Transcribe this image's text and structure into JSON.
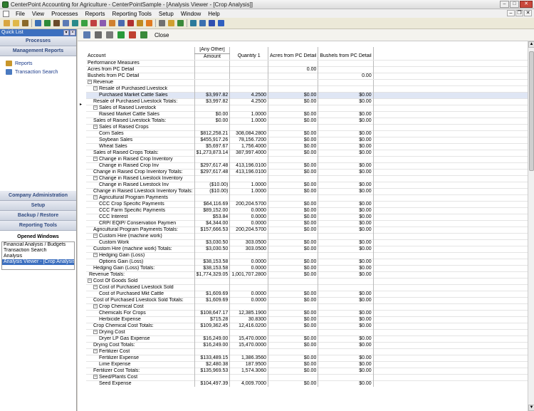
{
  "window": {
    "title": "CenterPoint Accounting for Agriculture - CenterPointSample - [Analysis Viewer - [Crop Analysis]]",
    "minimize_glyph": "–",
    "maximize_glyph": "□",
    "close_glyph": "✕"
  },
  "menu": {
    "items": [
      "File",
      "View",
      "Processes",
      "Reports",
      "Reporting Tools",
      "Setup",
      "Window",
      "Help"
    ],
    "mdi_minimize": "–",
    "mdi_restore": "❐",
    "mdi_close": "✕"
  },
  "toolbar": {
    "icons": [
      {
        "name": "new-icon",
        "color": "#d9a640"
      },
      {
        "name": "open-icon",
        "color": "#e0b84a"
      },
      {
        "name": "scale-icon",
        "color": "#8a6a2a"
      },
      {
        "name": "sep"
      },
      {
        "name": "contacts-icon",
        "color": "#3a6fb5"
      },
      {
        "name": "chart-icon",
        "color": "#2e8b3a"
      },
      {
        "name": "box-icon",
        "color": "#6a4a2a"
      },
      {
        "name": "grid-icon",
        "color": "#5a7ab5"
      },
      {
        "name": "ledger-icon",
        "color": "#2a8a8a"
      },
      {
        "name": "money-icon",
        "color": "#3aa040"
      },
      {
        "name": "invoice-icon",
        "color": "#c04040"
      },
      {
        "name": "payroll-icon",
        "color": "#8a5ab0"
      },
      {
        "name": "bank-icon",
        "color": "#d08030"
      },
      {
        "name": "report-icon",
        "color": "#4a6ab0"
      },
      {
        "name": "tractor-icon",
        "color": "#b03030"
      },
      {
        "name": "calendar-icon",
        "color": "#c08a20"
      },
      {
        "name": "clock-icon",
        "color": "#e07a20"
      },
      {
        "name": "sep"
      },
      {
        "name": "print-icon",
        "color": "#707070"
      },
      {
        "name": "email-icon",
        "color": "#d0a030"
      },
      {
        "name": "export-icon",
        "color": "#3a8a3a"
      },
      {
        "name": "sep"
      },
      {
        "name": "globe-icon",
        "color": "#2a7a9a"
      },
      {
        "name": "web-icon",
        "color": "#3a70b0"
      },
      {
        "name": "help-icon",
        "color": "#3050b0"
      },
      {
        "name": "info-icon",
        "color": "#3060c0"
      }
    ]
  },
  "quick_list": {
    "title": "Quick List",
    "pin_glyph": "▾",
    "close_glyph": "×",
    "top_sections": [
      "Processes",
      "Management Reports"
    ],
    "items": [
      {
        "label": "Reports",
        "icon": "reports-icon",
        "color": "#c8962a"
      },
      {
        "label": "Transaction Search",
        "icon": "search-icon",
        "color": "#4a7ac0"
      }
    ],
    "bottom_sections": [
      "Company Administration",
      "Setup",
      "Backup / Restore",
      "Reporting Tools"
    ],
    "opened_windows_title": "Opened Windows",
    "opened_windows": [
      {
        "label": "Financial Analysis / Budgets",
        "selected": false
      },
      {
        "label": "Transaction Search",
        "selected": false
      },
      {
        "label": "Analysis",
        "selected": false
      },
      {
        "label": "Analysis Viewer - [Crop Analysis]",
        "selected": true
      }
    ]
  },
  "viewer": {
    "toolbar_icons": [
      {
        "name": "save-icon",
        "color": "#5a7ab0"
      },
      {
        "name": "print-icon",
        "color": "#6a6a6a"
      },
      {
        "name": "preview-icon",
        "color": "#7a7a7a"
      },
      {
        "name": "filter-icon",
        "color": "#2a9a3a"
      },
      {
        "name": "excel-icon",
        "color": "#c04030"
      },
      {
        "name": "export-icon",
        "color": "#3a8a3a"
      }
    ],
    "close_label": "Close",
    "grid": {
      "header_group": "[Any Other]",
      "columns": [
        "Account",
        "Amount",
        "Quantity 1",
        "Acres from PC Detail",
        "Bushels from PC Detail"
      ],
      "performance": [
        {
          "label": "Performance Measures",
          "values": [
            "",
            "",
            "",
            ""
          ]
        },
        {
          "label": "Acres from PC Detail",
          "values": [
            "",
            "",
            "0.00",
            ""
          ]
        },
        {
          "label": "Bushels from PC Detail",
          "values": [
            "",
            "",
            "",
            "0.00"
          ]
        }
      ],
      "rows": [
        {
          "l": 0,
          "t": "g",
          "x": "Revenue"
        },
        {
          "l": 1,
          "t": "g",
          "x": "Resale of Purchased Livestock"
        },
        {
          "l": 2,
          "t": "d",
          "x": "Purchased Market Cattle Sales",
          "v": [
            "$3,997.82",
            "4.2500",
            "$0.00",
            "$0.00"
          ],
          "sel": true
        },
        {
          "l": 1,
          "t": "t",
          "x": "Resale of Purchased Livestock Totals:",
          "v": [
            "$3,997.82",
            "4.2500",
            "$0.00",
            "$0.00"
          ]
        },
        {
          "l": 1,
          "t": "g",
          "x": "Sales of Raised Livestock"
        },
        {
          "l": 2,
          "t": "d",
          "x": "Raised Market Cattle Sales",
          "v": [
            "$0.00",
            "1.0000",
            "$0.00",
            "$0.00"
          ]
        },
        {
          "l": 1,
          "t": "t",
          "x": "Sales of Raised Livestock Totals:",
          "v": [
            "$0.00",
            "1.0000",
            "$0.00",
            "$0.00"
          ]
        },
        {
          "l": 1,
          "t": "g",
          "x": "Sales of Raised Crops"
        },
        {
          "l": 2,
          "t": "d",
          "x": "Corn Sales",
          "v": [
            "$812,258.21",
            "308,084.2800",
            "$0.00",
            "$0.00"
          ]
        },
        {
          "l": 2,
          "t": "d",
          "x": "Soybean Sales",
          "v": [
            "$455,917.26",
            "78,156.7200",
            "$0.00",
            "$0.00"
          ]
        },
        {
          "l": 2,
          "t": "d",
          "x": "Wheat Sales",
          "v": [
            "$5,697.67",
            "1,756.4000",
            "$0.00",
            "$0.00"
          ]
        },
        {
          "l": 1,
          "t": "t",
          "x": "Sales of Raised Crops Totals:",
          "v": [
            "$1,273,873.14",
            "387,997.4000",
            "$0.00",
            "$0.00"
          ]
        },
        {
          "l": 1,
          "t": "g",
          "x": "Change in Raised Crop Inventory"
        },
        {
          "l": 2,
          "t": "d",
          "x": "Change in Raised Crop Inv",
          "v": [
            "$297,617.48",
            "413,196.0100",
            "$0.00",
            "$0.00"
          ]
        },
        {
          "l": 1,
          "t": "t",
          "x": "Change in Raised Crop Inventory Totals:",
          "v": [
            "$297,617.48",
            "413,196.0100",
            "$0.00",
            "$0.00"
          ]
        },
        {
          "l": 1,
          "t": "g",
          "x": "Change in Raised Livestock Inventory"
        },
        {
          "l": 2,
          "t": "d",
          "x": "Change in Raised Livestock Inv",
          "v": [
            "($10.00)",
            "1.0000",
            "$0.00",
            "$0.00"
          ]
        },
        {
          "l": 1,
          "t": "t",
          "x": "Change in Raised Livestock Inventory Totals:",
          "v": [
            "($10.00)",
            "1.0000",
            "$0.00",
            "$0.00"
          ]
        },
        {
          "l": 1,
          "t": "g",
          "x": "Agricultural Program Payments"
        },
        {
          "l": 2,
          "t": "d",
          "x": "CCC Crop Specific Payments",
          "v": [
            "$64,116.69",
            "200,204.5700",
            "$0.00",
            "$0.00"
          ]
        },
        {
          "l": 2,
          "t": "d",
          "x": "CCC Farm Specific Payments",
          "v": [
            "$89,152.00",
            "0.0000",
            "$0.00",
            "$0.00"
          ]
        },
        {
          "l": 2,
          "t": "d",
          "x": "CCC Interest",
          "v": [
            "$53.84",
            "0.0000",
            "$0.00",
            "$0.00"
          ]
        },
        {
          "l": 2,
          "t": "d",
          "x": "CRP/ EQIP/ Conservation Paymen",
          "v": [
            "$4,344.00",
            "0.0000",
            "$0.00",
            "$0.00"
          ]
        },
        {
          "l": 1,
          "t": "t",
          "x": "Agricultural Program Payments Totals:",
          "v": [
            "$157,666.53",
            "200,204.5700",
            "$0.00",
            "$0.00"
          ]
        },
        {
          "l": 1,
          "t": "g",
          "x": "Custom Hire (machine work)"
        },
        {
          "l": 2,
          "t": "d",
          "x": "Custom Work",
          "v": [
            "$3,030.50",
            "303.0500",
            "$0.00",
            "$0.00"
          ]
        },
        {
          "l": 1,
          "t": "t",
          "x": "Custom Hire (machine work) Totals:",
          "v": [
            "$3,030.50",
            "303.0500",
            "$0.00",
            "$0.00"
          ]
        },
        {
          "l": 1,
          "t": "g",
          "x": "Hedging Gain (Loss)"
        },
        {
          "l": 2,
          "t": "d",
          "x": "Options Gain (Loss)",
          "v": [
            "$38,153.58",
            "0.0000",
            "$0.00",
            "$0.00"
          ]
        },
        {
          "l": 1,
          "t": "t",
          "x": "Hedging Gain (Loss) Totals:",
          "v": [
            "$38,153.58",
            "0.0000",
            "$0.00",
            "$0.00"
          ]
        },
        {
          "l": 0,
          "t": "t",
          "x": "Revenue Totals:",
          "v": [
            "$1,774,329.05",
            "1,001,707.2800",
            "$0.00",
            "$0.00"
          ]
        },
        {
          "l": 0,
          "t": "g",
          "x": "Cost Of Goods Sold"
        },
        {
          "l": 1,
          "t": "g",
          "x": "Cost of Purchased Livestock Sold"
        },
        {
          "l": 2,
          "t": "d",
          "x": "Cost of Purchased Mkt Cattle",
          "v": [
            "$1,609.69",
            "0.0000",
            "$0.00",
            "$0.00"
          ]
        },
        {
          "l": 1,
          "t": "t",
          "x": "Cost of Purchased Livestock Sold Totals:",
          "v": [
            "$1,609.69",
            "0.0000",
            "$0.00",
            "$0.00"
          ]
        },
        {
          "l": 1,
          "t": "g",
          "x": "Crop Chemical Cost"
        },
        {
          "l": 2,
          "t": "d",
          "x": "Chemicals For Crops",
          "v": [
            "$108,647.17",
            "12,385.1900",
            "$0.00",
            "$0.00"
          ]
        },
        {
          "l": 2,
          "t": "d",
          "x": "Herbicide Expense",
          "v": [
            "$715.28",
            "30.8300",
            "$0.00",
            "$0.00"
          ]
        },
        {
          "l": 1,
          "t": "t",
          "x": "Crop Chemical Cost Totals:",
          "v": [
            "$109,362.45",
            "12,416.0200",
            "$0.00",
            "$0.00"
          ]
        },
        {
          "l": 1,
          "t": "g",
          "x": "Drying Cost"
        },
        {
          "l": 2,
          "t": "d",
          "x": "Dryer LP Gas Expense",
          "v": [
            "$16,249.00",
            "15,470.0000",
            "$0.00",
            "$0.00"
          ]
        },
        {
          "l": 1,
          "t": "t",
          "x": "Drying Cost Totals:",
          "v": [
            "$16,249.00",
            "15,470.0000",
            "$0.00",
            "$0.00"
          ]
        },
        {
          "l": 1,
          "t": "g",
          "x": "Fertilizer Cost"
        },
        {
          "l": 2,
          "t": "d",
          "x": "Fertilizer Expense",
          "v": [
            "$133,489.15",
            "1,386.3560",
            "$0.00",
            "$0.00"
          ]
        },
        {
          "l": 2,
          "t": "d",
          "x": "Lime Expense",
          "v": [
            "$2,480.38",
            "187.9500",
            "$0.00",
            "$0.00"
          ]
        },
        {
          "l": 1,
          "t": "t",
          "x": "Fertilizer Cost Totals:",
          "v": [
            "$135,969.53",
            "1,574.3060",
            "$0.00",
            "$0.00"
          ]
        },
        {
          "l": 1,
          "t": "g",
          "x": "Seed/Plants Cost"
        },
        {
          "l": 2,
          "t": "d",
          "x": "Seed Expense",
          "v": [
            "$104,497.39",
            "4,009.7000",
            "$0.00",
            "$0.00"
          ]
        }
      ]
    }
  }
}
